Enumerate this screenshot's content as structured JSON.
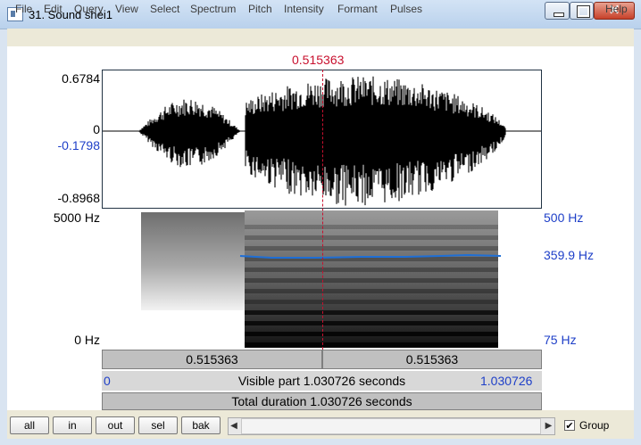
{
  "window": {
    "title": "31. Sound shei1",
    "close_glyph": "✕"
  },
  "menu": [
    "File",
    "Edit",
    "Query",
    "View",
    "Select",
    "Spectrum",
    "Pitch",
    "Intensity",
    "Formant",
    "Pulses",
    "Help"
  ],
  "cursor_time": "0.515363",
  "waveform": {
    "max_label": "0.6784",
    "zero_label": "0",
    "cursor_value": "-0.1798",
    "min_label": "-0.8968"
  },
  "spectrogram": {
    "top_freq": "5000 Hz",
    "bottom_freq": "0 Hz"
  },
  "pitch": {
    "top": "500 Hz",
    "value": "359.9 Hz",
    "bottom": "75 Hz",
    "line_color": "#1f6fd6"
  },
  "time_bars": {
    "left_segment": "0.515363",
    "right_segment": "0.515363",
    "visible_start": "0",
    "visible_text": "Visible part 1.030726 seconds",
    "visible_end": "1.030726",
    "total_text": "Total duration 1.030726 seconds"
  },
  "buttons": {
    "all": "all",
    "in": "in",
    "out": "out",
    "sel": "sel",
    "bak": "bak"
  },
  "scroll": {
    "left_arrow": "◀",
    "right_arrow": "▶"
  },
  "group": {
    "checked_glyph": "✔",
    "label": "Group"
  }
}
